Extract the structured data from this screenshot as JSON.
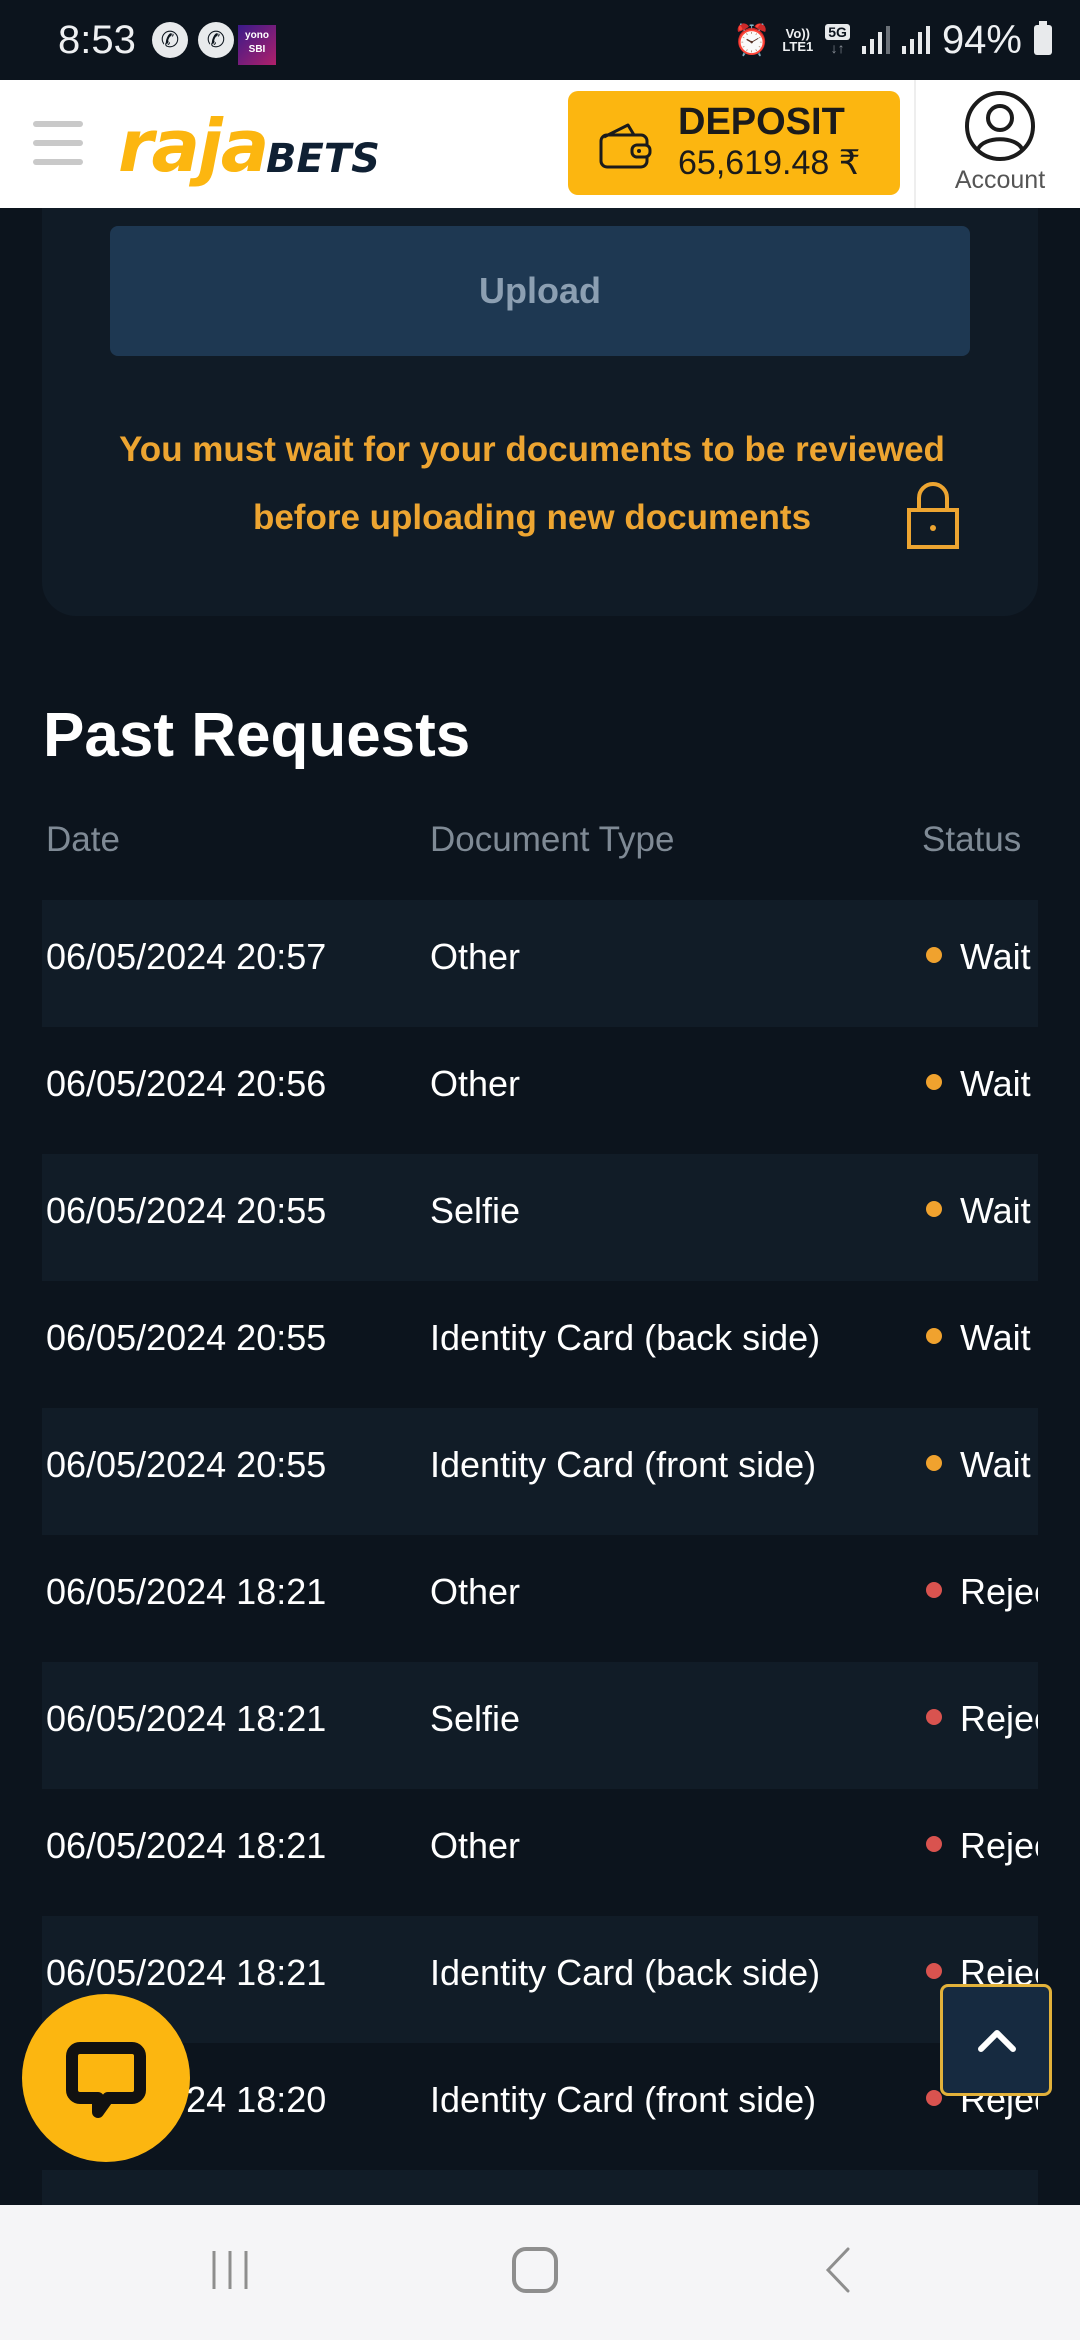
{
  "status_bar": {
    "time": "8:53",
    "notification_icons": [
      "call-icon",
      "call-icon",
      "yono-sbi-icon"
    ],
    "yono_label_top": "yono",
    "yono_label_bottom": "SBI",
    "volte_label_top": "Vo))",
    "volte_label_bottom": "LTE1",
    "network_label": "5G",
    "network_arrows": "↓↑",
    "battery": "94%"
  },
  "header": {
    "logo_primary": "raja",
    "logo_secondary": "BETS",
    "deposit_label": "DEPOSIT",
    "deposit_amount": "65,619.48 ₹",
    "account_label": "Account"
  },
  "upload_card": {
    "upload_label": "Upload",
    "notice": "You must wait for your documents to be reviewed before uploading new documents"
  },
  "past_requests": {
    "title": "Past Requests",
    "columns": [
      "Date",
      "Document Type",
      "Status"
    ],
    "rows": [
      {
        "date": "06/05/2024 20:57",
        "type": "Other",
        "status": "Wait",
        "status_color": "#f0a22e"
      },
      {
        "date": "06/05/2024 20:56",
        "type": "Other",
        "status": "Wait",
        "status_color": "#f0a22e"
      },
      {
        "date": "06/05/2024 20:55",
        "type": "Selfie",
        "status": "Wait",
        "status_color": "#f0a22e"
      },
      {
        "date": "06/05/2024 20:55",
        "type": "Identity Card (back side)",
        "status": "Wait",
        "status_color": "#f0a22e"
      },
      {
        "date": "06/05/2024 20:55",
        "type": "Identity Card (front side)",
        "status": "Wait",
        "status_color": "#f0a22e"
      },
      {
        "date": "06/05/2024 18:21",
        "type": "Other",
        "status": "Rejected",
        "status_color": "#d9534f"
      },
      {
        "date": "06/05/2024 18:21",
        "type": "Selfie",
        "status": "Rejected",
        "status_color": "#d9534f"
      },
      {
        "date": "06/05/2024 18:21",
        "type": "Other",
        "status": "Rejected",
        "status_color": "#d9534f"
      },
      {
        "date": "06/05/2024 18:21",
        "type": "Identity Card (back side)",
        "status": "Rejected",
        "status_color": "#d9534f"
      },
      {
        "date": "06/05/2024 18:20",
        "type": "Identity Card (front side)",
        "status": "Rejected",
        "status_color": "#d9534f"
      },
      {
        "date": "",
        "type": "",
        "status": "",
        "status_color": ""
      }
    ]
  },
  "colors": {
    "brand_yellow": "#fcb610",
    "background": "#0c141d",
    "notice": "#eda531",
    "wait": "#f0a22e",
    "rejected": "#d9534f"
  }
}
